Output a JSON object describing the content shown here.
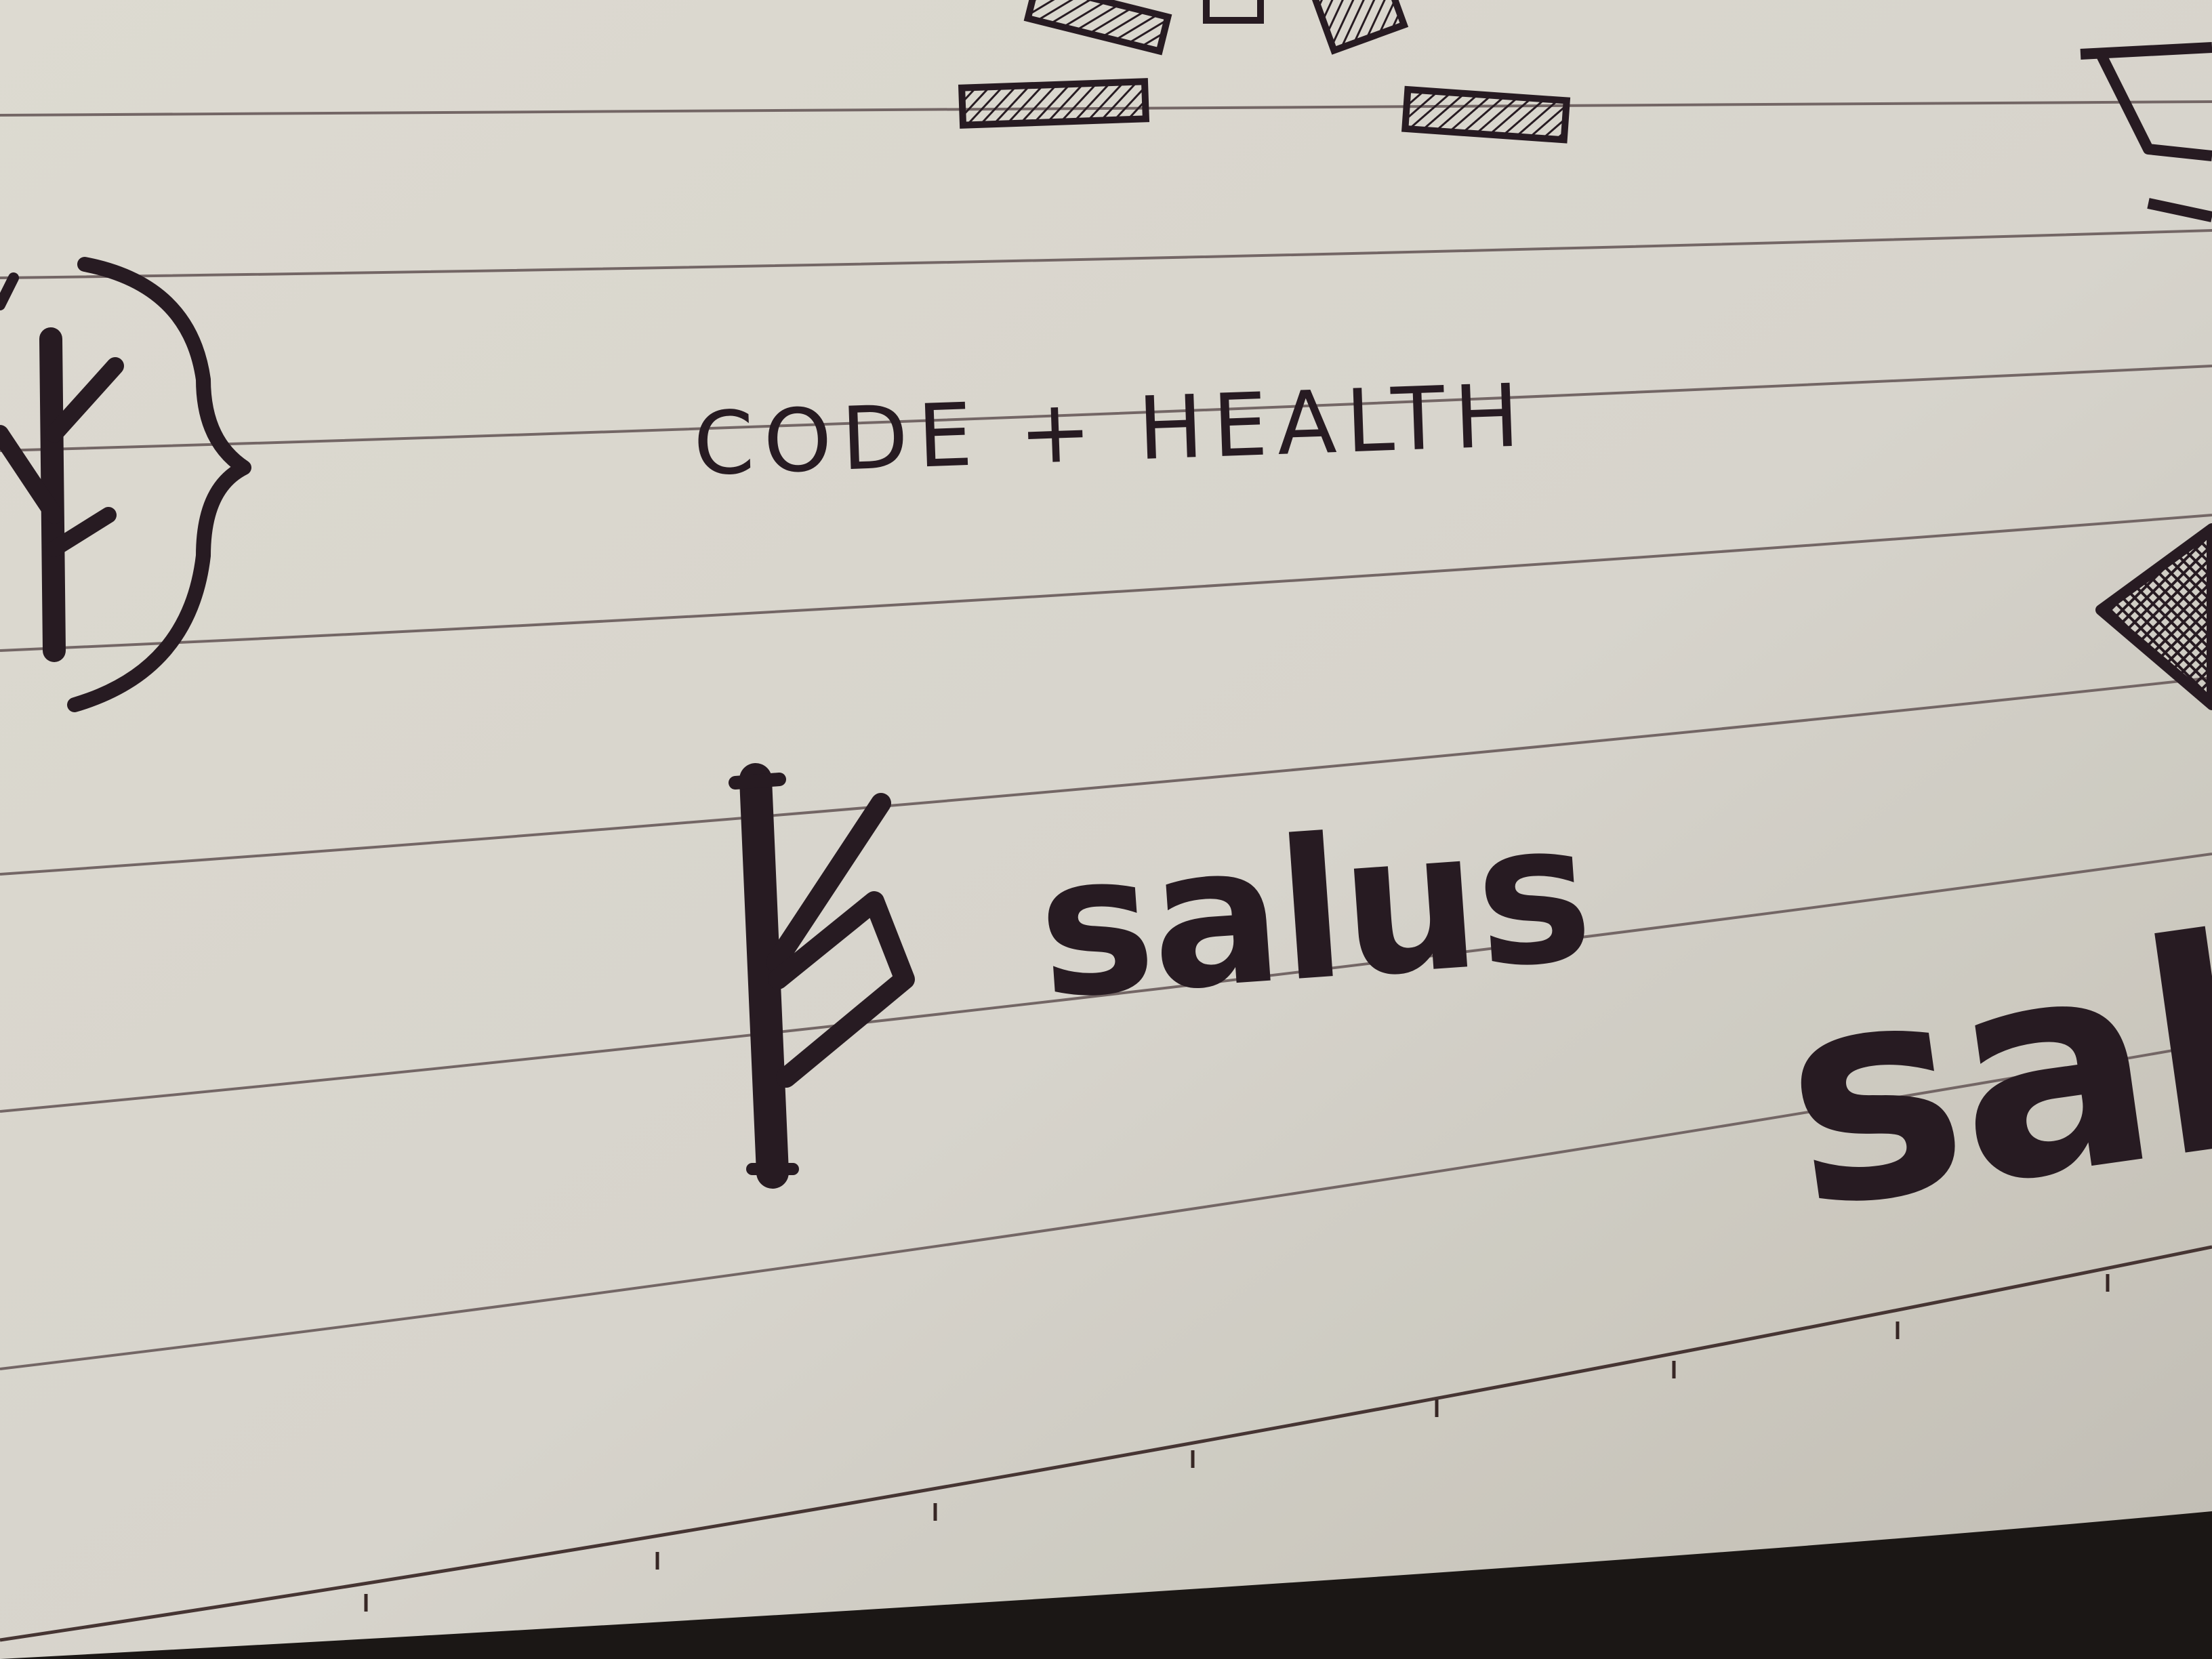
{
  "sketch": {
    "tagline": "CODE + HEALTH",
    "brand_name": "salus",
    "brand_name_partial": "sal"
  },
  "colors": {
    "paper": "#e6e3da",
    "paper_shadow": "#cfcbc1",
    "ink": "#2a1d24",
    "rule_line": "#7a6c6b",
    "background": "#1d1917"
  },
  "icons": {
    "left_mark": "tree-rune-icon",
    "main_mark": "rune-logo-icon",
    "top_sketch": "sunburst-rays-icon"
  }
}
